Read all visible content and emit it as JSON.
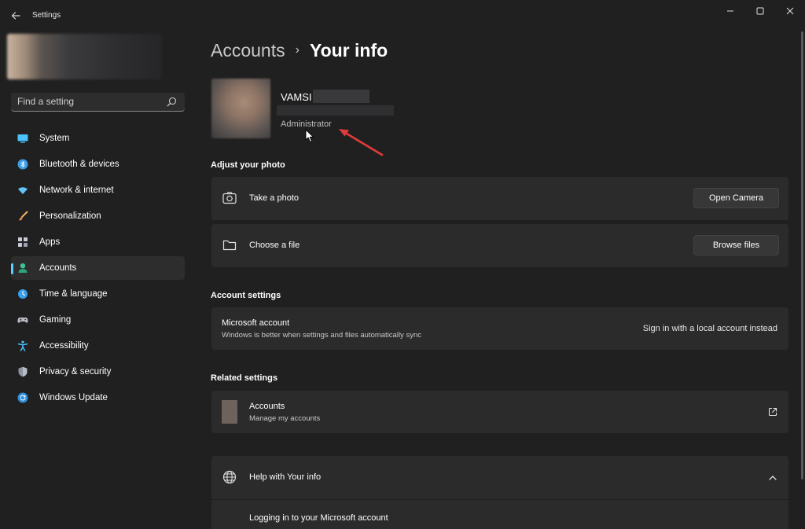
{
  "window": {
    "title": "Settings"
  },
  "sidebar": {
    "search_placeholder": "Find a setting",
    "items": [
      {
        "label": "System",
        "icon": "monitor-icon",
        "selected": false
      },
      {
        "label": "Bluetooth & devices",
        "icon": "bluetooth-icon",
        "selected": false
      },
      {
        "label": "Network & internet",
        "icon": "wifi-icon",
        "selected": false
      },
      {
        "label": "Personalization",
        "icon": "paintbrush-icon",
        "selected": false
      },
      {
        "label": "Apps",
        "icon": "apps-grid-icon",
        "selected": false
      },
      {
        "label": "Accounts",
        "icon": "person-icon",
        "selected": true
      },
      {
        "label": "Time & language",
        "icon": "globe-clock-icon",
        "selected": false
      },
      {
        "label": "Gaming",
        "icon": "gamepad-icon",
        "selected": false
      },
      {
        "label": "Accessibility",
        "icon": "accessibility-icon",
        "selected": false
      },
      {
        "label": "Privacy & security",
        "icon": "shield-icon",
        "selected": false
      },
      {
        "label": "Windows Update",
        "icon": "update-icon",
        "selected": false
      }
    ]
  },
  "breadcrumb": {
    "parent": "Accounts",
    "separator": "›",
    "current": "Your info"
  },
  "user": {
    "name": "VAMSI",
    "role": "Administrator"
  },
  "adjust_photo": {
    "heading": "Adjust your photo",
    "take_photo": {
      "label": "Take a photo",
      "button": "Open Camera"
    },
    "choose_file": {
      "label": "Choose a file",
      "button": "Browse files"
    }
  },
  "account_settings": {
    "heading": "Account settings",
    "ms_account": {
      "title": "Microsoft account",
      "subtitle": "Windows is better when settings and files automatically sync",
      "link": "Sign in with a local account instead"
    }
  },
  "related": {
    "heading": "Related settings",
    "accounts": {
      "title": "Accounts",
      "subtitle": "Manage my accounts"
    }
  },
  "help": {
    "title": "Help with Your info",
    "item": "Logging in to your Microsoft account"
  },
  "colors": {
    "accent": "#60cdff",
    "background": "#202020",
    "card": "#2b2b2b",
    "annotation": "#e23b3b"
  }
}
